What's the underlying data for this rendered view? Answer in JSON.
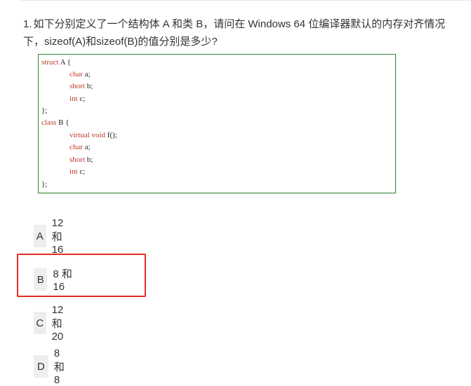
{
  "question": {
    "number": "1.",
    "text": "如下分别定义了一个结构体 A 和类 B，请问在 Windows 64 位编译器默认的内存对齐情况下，sizeof(A)和sizeof(B)的值分别是多少?"
  },
  "code": {
    "lines": [
      {
        "kw": "struct",
        "rest": " A {"
      },
      {
        "kw": "char",
        "rest": " a;"
      },
      {
        "kw": "short",
        "rest": " b;"
      },
      {
        "kw": "int",
        "rest": " c;"
      },
      {
        "kw": "",
        "rest": "};"
      },
      {
        "kw": "class",
        "rest": " B {"
      },
      {
        "kw": "virtual void",
        "rest": " f();"
      },
      {
        "kw": "char",
        "rest": " a;"
      },
      {
        "kw": "short",
        "rest": " b;"
      },
      {
        "kw": "int",
        "rest": " c;"
      },
      {
        "kw": "",
        "rest": "};"
      }
    ]
  },
  "options": [
    {
      "letter": "A",
      "label": "12 和 16"
    },
    {
      "letter": "B",
      "label": "8 和 16"
    },
    {
      "letter": "C",
      "label": "12 和 20"
    },
    {
      "letter": "D",
      "label": "8 和 8"
    }
  ],
  "colors": {
    "code_border": "#2e8b2e",
    "keyword": "#c0392b",
    "highlight": "#e52a24"
  }
}
